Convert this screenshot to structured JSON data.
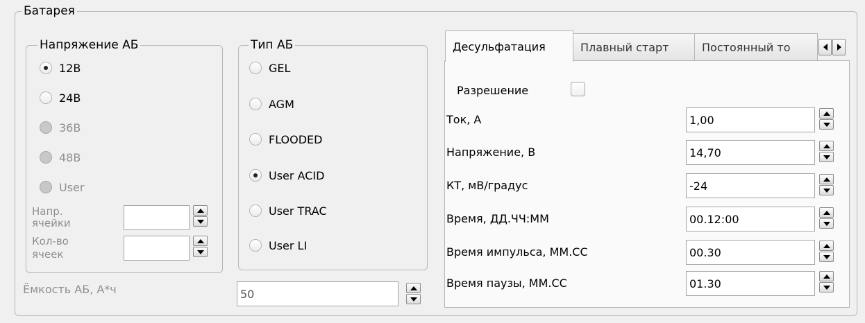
{
  "battery": {
    "title": "Батарея",
    "voltage_group": {
      "title": "Напряжение АБ",
      "options": [
        "12В",
        "24В",
        "36В",
        "48В",
        "User"
      ],
      "selected": "12В",
      "cell_voltage_label_line1": "Напр.",
      "cell_voltage_label_line2": "ячейки",
      "cell_voltage_value": "",
      "cell_count_label_line1": "Кол-во",
      "cell_count_label_line2": "ячеек",
      "cell_count_value": ""
    },
    "type_group": {
      "title": "Тип АБ",
      "options": [
        "GEL",
        "AGM",
        "FLOODED",
        "User ACID",
        "User TRAC",
        "User LI"
      ],
      "selected": "User ACID"
    },
    "capacity_label": "Ёмкость АБ, А*ч",
    "capacity_value": "50"
  },
  "tabs": {
    "items": [
      "Десульфатация",
      "Плавный старт",
      "Постоянный то"
    ],
    "active": "Десульфатация"
  },
  "desulfation": {
    "enable_label": "Разрешение",
    "enabled": false,
    "fields": [
      {
        "label": "Ток, А",
        "value": "1,00"
      },
      {
        "label": "Напряжение, В",
        "value": "14,70"
      },
      {
        "label": "КТ, мВ/градус",
        "value": "-24"
      },
      {
        "label": "Время, ДД.ЧЧ:ММ",
        "value": "00.12:00"
      },
      {
        "label": "Время импульса, ММ.СС",
        "value": "00.30"
      },
      {
        "label": "Время паузы, ММ.СС",
        "value": "01.30"
      }
    ]
  }
}
